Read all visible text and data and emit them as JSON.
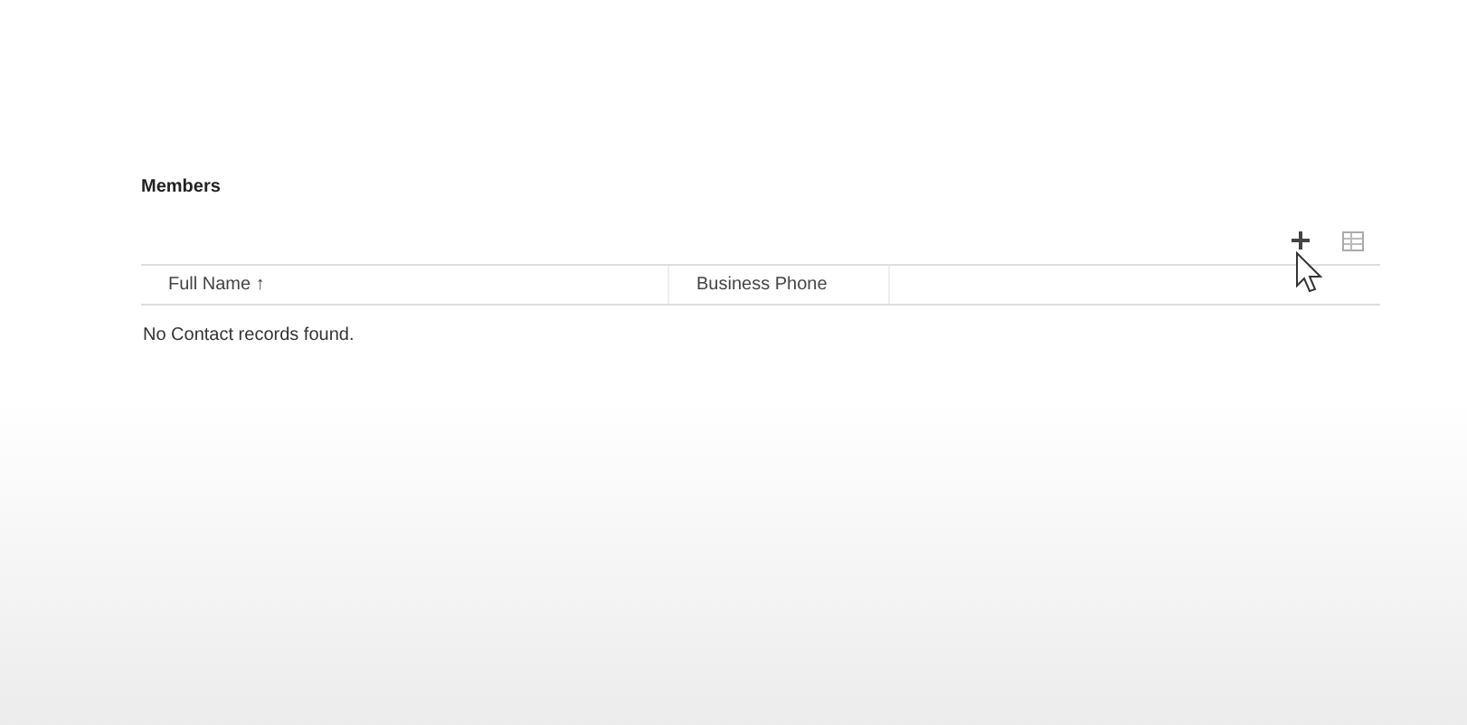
{
  "section": {
    "title": "Members"
  },
  "table": {
    "columns": [
      {
        "label": "Full Name",
        "sort_mark": "↑"
      },
      {
        "label": "Business Phone"
      }
    ],
    "empty_message": "No Contact records found."
  }
}
